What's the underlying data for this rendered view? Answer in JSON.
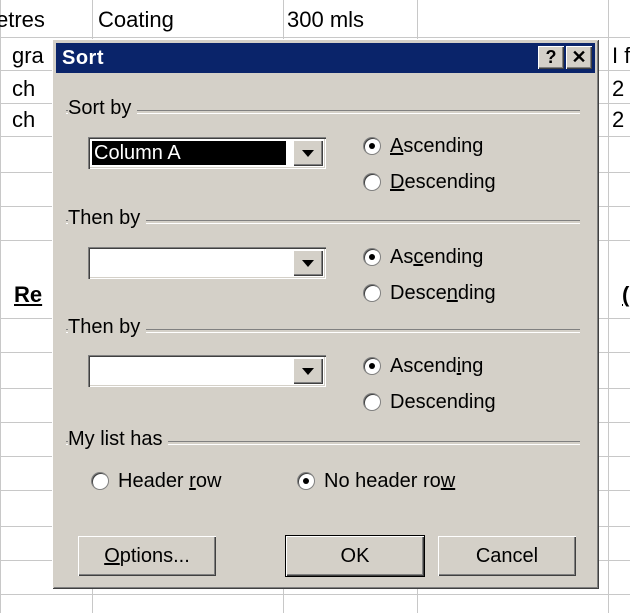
{
  "sheet": {
    "row1": [
      "etres",
      "Coating",
      "300 mls"
    ],
    "col_left": [
      "gra",
      "ch",
      "ch"
    ],
    "col_right": [
      "I f",
      "2",
      "2"
    ],
    "heading_left": "Re",
    "heading_right": "("
  },
  "dialog": {
    "title": "Sort",
    "help_button": "?",
    "close_button": "✕",
    "sort_by": {
      "label": "Sort by",
      "value": "Column A",
      "ascending": {
        "pre": "",
        "key": "A",
        "post": "scending"
      },
      "descending": {
        "pre": "",
        "key": "D",
        "post": "escending"
      },
      "selected": "ascending"
    },
    "then_by_1": {
      "label": "Then by",
      "value": "",
      "ascending": {
        "pre": "As",
        "key": "c",
        "post": "ending"
      },
      "descending": {
        "pre": "Desce",
        "key": "n",
        "post": "ding"
      },
      "selected": "ascending"
    },
    "then_by_2": {
      "label": "Then by",
      "value": "",
      "ascending": {
        "pre": "Ascend",
        "key": "i",
        "post": "ng"
      },
      "descending": {
        "pre": "Descendin",
        "key": "g",
        "post": ""
      },
      "selected": "ascending"
    },
    "list_has": {
      "label": "My list has",
      "header_row": {
        "pre": "Header ",
        "key": "r",
        "post": "ow"
      },
      "no_header_row": {
        "pre": "No header ro",
        "key": "w",
        "post": ""
      },
      "selected": "no_header_row"
    },
    "buttons": {
      "options": {
        "pre": "",
        "key": "O",
        "post": "ptions..."
      },
      "ok": "OK",
      "cancel": "Cancel"
    }
  }
}
